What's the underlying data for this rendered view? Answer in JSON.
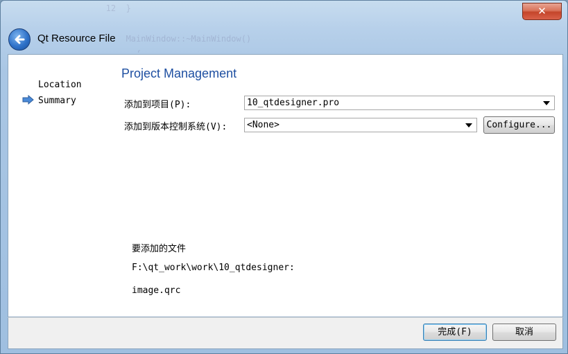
{
  "window": {
    "title": "Qt Resource File",
    "close_glyph": "✕"
  },
  "background_code": [
    "   12  }",
    "",
    "       MainWindow::~MainWindow()",
    "         {"
  ],
  "nav": {
    "items": [
      {
        "label": "Location",
        "current": false
      },
      {
        "label": "Summary",
        "current": true
      }
    ]
  },
  "page": {
    "heading": "Project Management",
    "add_to_project_label": "添加到项目(P):",
    "project_value": "10_qtdesigner.pro",
    "add_to_vcs_label": "添加到版本控制系统(V):",
    "vcs_value": "<None>",
    "configure_label": "Configure...",
    "files_heading": "要添加的文件",
    "files_path": "F:\\qt_work\\work\\10_qtdesigner:",
    "files_list": "image.qrc"
  },
  "footer": {
    "finish_label": "完成(F)",
    "cancel_label": "取消"
  },
  "colors": {
    "heading": "#1e4fa1",
    "accent": "#2f72c9"
  }
}
